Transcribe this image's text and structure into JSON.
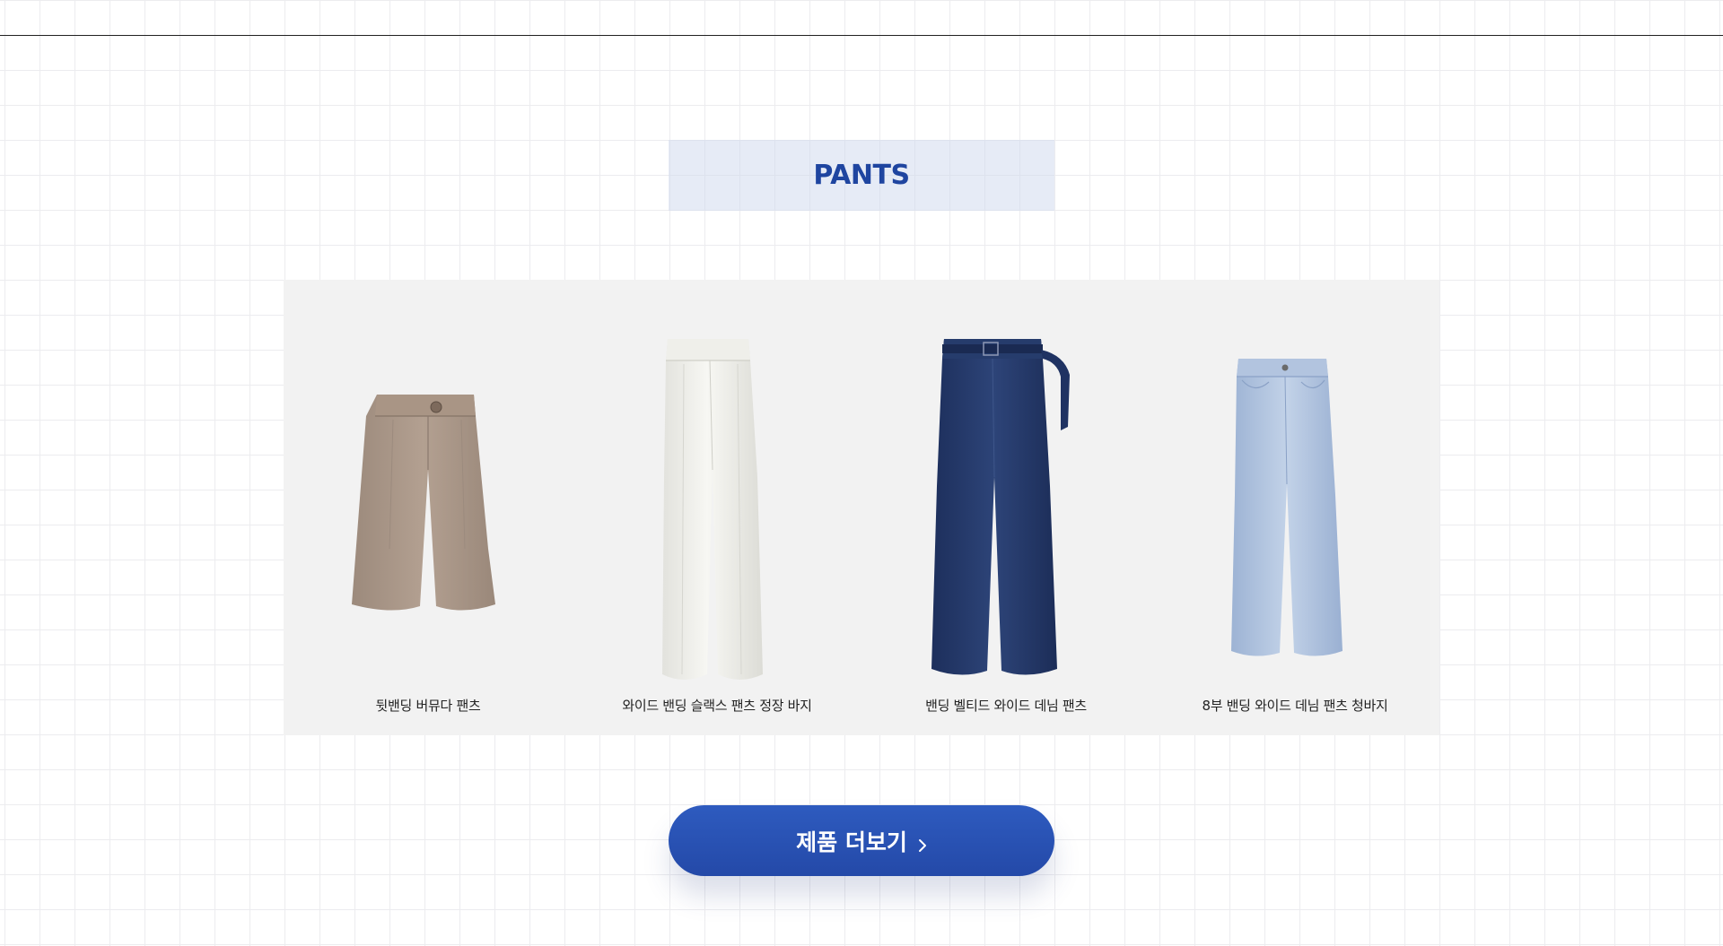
{
  "section": {
    "title": "PANTS"
  },
  "products": [
    {
      "name": "뒷밴딩 버뮤다 팬츠",
      "image": "beige-bermuda-shorts"
    },
    {
      "name": "와이드 밴딩 슬랙스 팬츠 정장 바지",
      "image": "white-wide-slacks"
    },
    {
      "name": "밴딩 벨티드 와이드 데님 팬츠",
      "image": "dark-denim-belted-wide-pants"
    },
    {
      "name": "8부 밴딩 와이드 데님 팬츠 청바지",
      "image": "light-denim-cropped-wide-pants"
    }
  ],
  "more_button": {
    "label": "제품 더보기",
    "icon": "chevron-right-icon"
  },
  "colors": {
    "accent": "#2449a8",
    "title_text": "#1f45a0",
    "title_bg": "#e6ebf5",
    "panel_bg": "#f2f2f2"
  }
}
